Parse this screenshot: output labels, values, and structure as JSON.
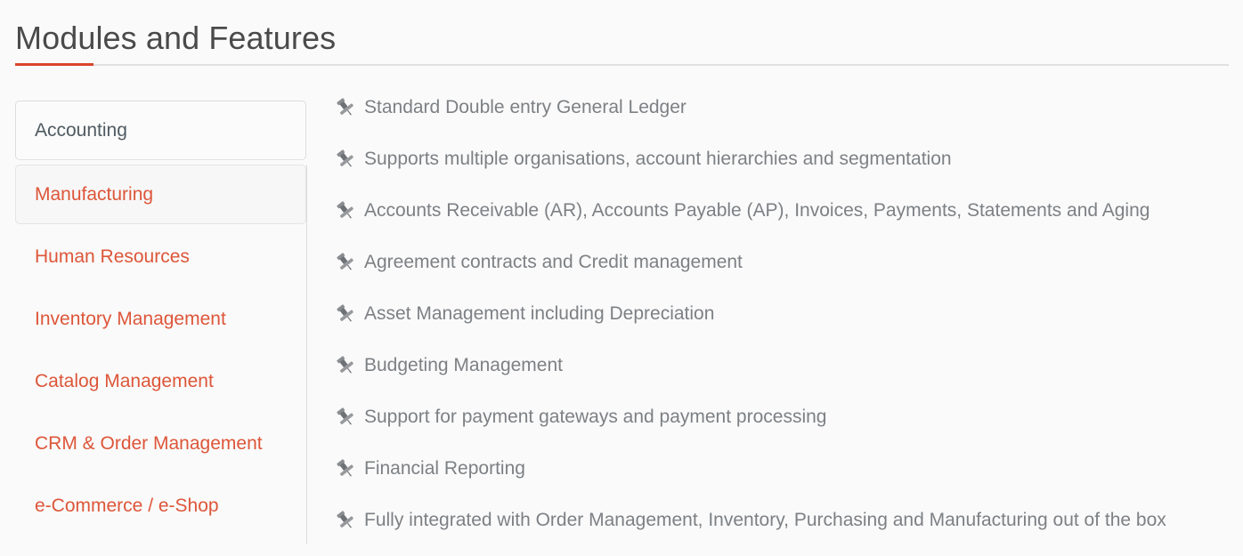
{
  "header": {
    "title": "Modules and Features",
    "accent_color": "#d9452c",
    "rule_color": "#e0e0e0"
  },
  "sidebar": {
    "link_color": "#dd5639",
    "active_color": "#4f5a61",
    "items": [
      {
        "label": "Accounting",
        "state": "active"
      },
      {
        "label": "Manufacturing",
        "state": "hovered"
      },
      {
        "label": "Human Resources",
        "state": "default"
      },
      {
        "label": "Inventory Management",
        "state": "default"
      },
      {
        "label": "Catalog Management",
        "state": "default"
      },
      {
        "label": "CRM & Order Management",
        "state": "default"
      },
      {
        "label": "e-Commerce / e-Shop",
        "state": "default"
      }
    ]
  },
  "features": {
    "icon": "pushpin-icon",
    "text_color": "#7d8084",
    "items": [
      "Standard Double entry General Ledger",
      "Supports multiple organisations, account hierarchies and segmentation",
      "Accounts Receivable (AR), Accounts Payable (AP), Invoices, Payments, Statements and Aging",
      "Agreement contracts and Credit management",
      "Asset Management including Depreciation",
      "Budgeting Management",
      "Support for payment gateways and payment processing",
      "Financial Reporting",
      "Fully integrated with Order Management, Inventory, Purchasing and Manufacturing out of the box"
    ]
  }
}
